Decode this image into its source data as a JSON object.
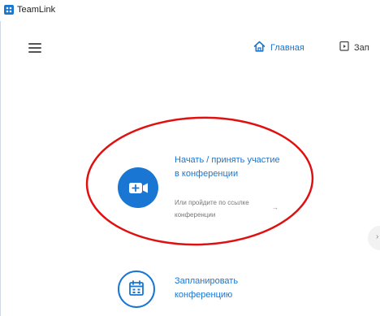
{
  "app": {
    "title": "TeamLink",
    "logo_icon": "teamlink-logo-icon"
  },
  "header": {
    "menu_icon": "hamburger-menu-icon",
    "tabs": [
      {
        "label": "Главная",
        "icon": "home-icon",
        "active": true,
        "color": "#1976d2"
      },
      {
        "label": "Зап",
        "icon": "calendar-icon",
        "active": false
      }
    ]
  },
  "main": {
    "join": {
      "title": "Начать / принять участие в конференции",
      "subtitle": "Или пройдите по ссылке конференции",
      "icon": "video-camera-icon",
      "arrow_icon": "arrow-right-icon"
    },
    "schedule": {
      "title": "Запланировать конференцию",
      "icon": "calendar-icon"
    },
    "side_arrow_icon": "chevron-right-icon"
  },
  "annotation": {
    "shape": "ellipse",
    "color": "#e01010"
  },
  "colors": {
    "accent": "#1976d2",
    "annotation": "#e01010"
  }
}
